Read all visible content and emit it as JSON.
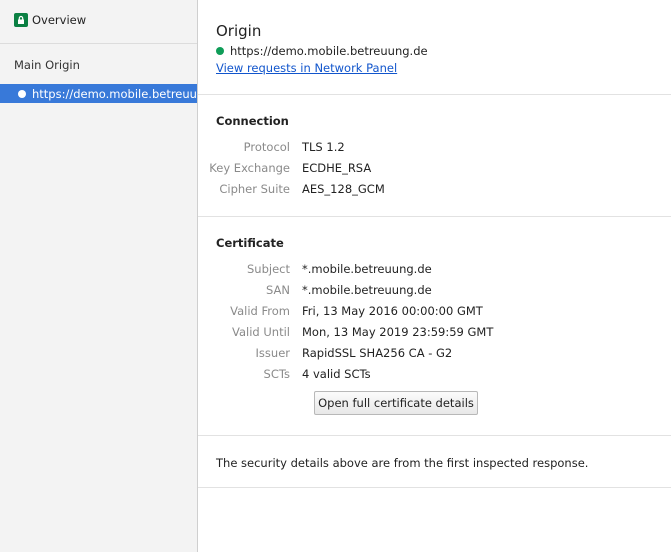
{
  "sidebar": {
    "overview_label": "Overview",
    "section_label": "Main Origin",
    "origin_item": "https://demo.mobile.betreuung.de"
  },
  "origin": {
    "title": "Origin",
    "url": "https://demo.mobile.betreuung.de",
    "network_link": "View requests in Network Panel"
  },
  "connection": {
    "title": "Connection",
    "rows": [
      {
        "key": "Protocol",
        "value": "TLS 1.2"
      },
      {
        "key": "Key Exchange",
        "value": "ECDHE_RSA"
      },
      {
        "key": "Cipher Suite",
        "value": "AES_128_GCM"
      }
    ]
  },
  "certificate": {
    "title": "Certificate",
    "rows": [
      {
        "key": "Subject",
        "value": "*.mobile.betreuung.de"
      },
      {
        "key": "SAN",
        "value": "*.mobile.betreuung.de"
      },
      {
        "key": "Valid From",
        "value": "Fri, 13 May 2016 00:00:00 GMT"
      },
      {
        "key": "Valid Until",
        "value": "Mon, 13 May 2019 23:59:59 GMT"
      },
      {
        "key": "Issuer",
        "value": "RapidSSL SHA256 CA - G2"
      },
      {
        "key": "SCTs",
        "value": "4 valid SCTs"
      }
    ],
    "button_label": "Open full certificate details"
  },
  "footer_note": "The security details above are from the first inspected response.",
  "colors": {
    "secure_green": "#0f9d58",
    "selection_blue": "#3879d9",
    "link_blue": "#1155cc"
  },
  "icons": {
    "overview": "lock-icon",
    "origin_status": "secure-dot-icon",
    "sidebar_origin": "origin-dot-icon"
  }
}
